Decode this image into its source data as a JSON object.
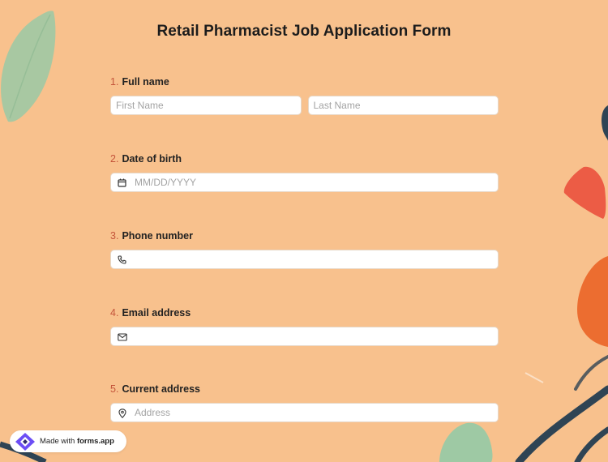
{
  "form": {
    "title": "Retail Pharmacist Job Application Form",
    "questions": [
      {
        "number": "1.",
        "label": "Full name",
        "fields": [
          {
            "placeholder": "First Name",
            "value": ""
          },
          {
            "placeholder": "Last Name",
            "value": ""
          }
        ]
      },
      {
        "number": "2.",
        "label": "Date of birth",
        "fields": [
          {
            "placeholder": "MM/DD/YYYY",
            "value": "",
            "icon": "calendar-icon"
          }
        ]
      },
      {
        "number": "3.",
        "label": "Phone number",
        "fields": [
          {
            "placeholder": "",
            "value": "",
            "icon": "phone-icon"
          }
        ]
      },
      {
        "number": "4.",
        "label": "Email address",
        "fields": [
          {
            "placeholder": "",
            "value": "",
            "icon": "envelope-icon"
          }
        ]
      },
      {
        "number": "5.",
        "label": "Current address",
        "fields": [
          {
            "placeholder": "Address",
            "value": "",
            "icon": "map-pin-icon"
          }
        ]
      }
    ]
  },
  "badge": {
    "prefix": "Made with",
    "brand": "forms.app",
    "icon": "forms-app-logo"
  },
  "colors": {
    "background": "#f8c18d",
    "number_accent": "#c4543a",
    "logo_accent": "#6c4ef5"
  }
}
